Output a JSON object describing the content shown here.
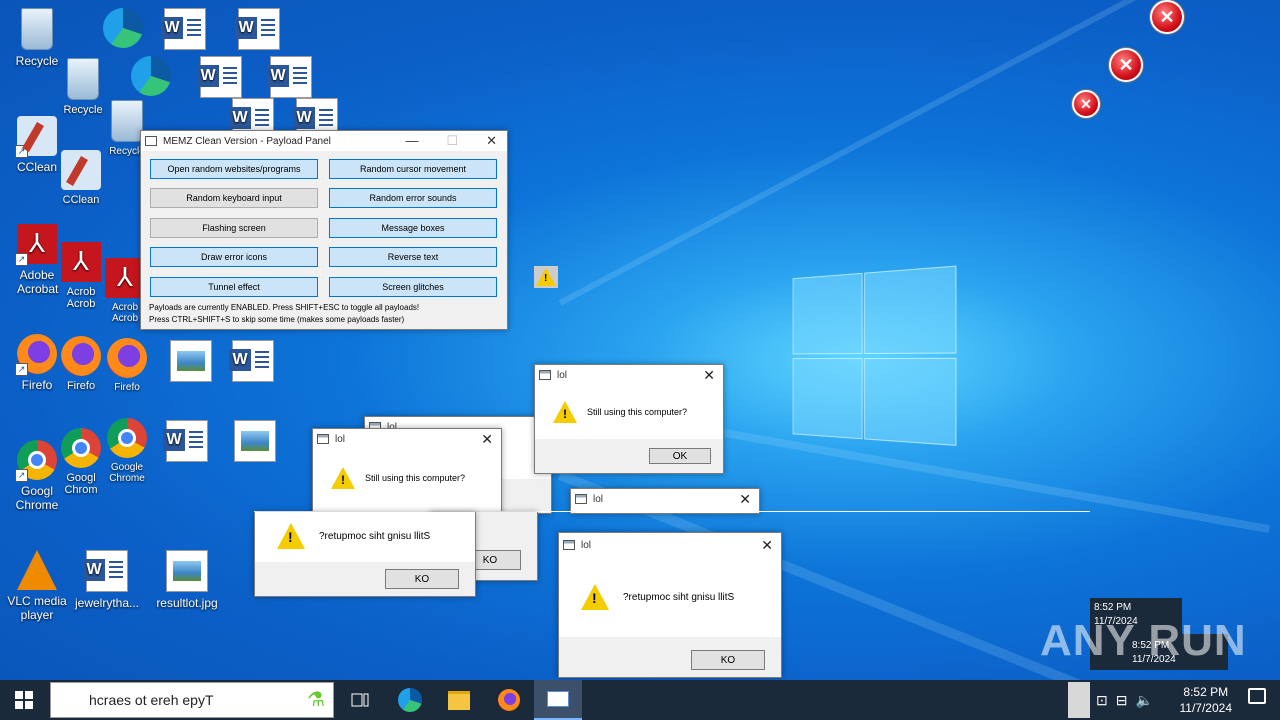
{
  "desktop": {
    "icons": {
      "recycle_label": "Recycle",
      "recycle2_label": "Recycle",
      "recycle3_label": "Recycle",
      "ccleaner_label": "CClean",
      "ccleaner2_label": "CClean",
      "acrobat_label": "Adobe Acrobat",
      "acrobat2_label": "Acrob Acrob",
      "acrobat3_label": "Acrob Acrob",
      "firefox_label": "Firefo",
      "firefox2_label": "Firefo",
      "firefox3_label": "Firefo",
      "chrome_label": "Googl Chrome",
      "chrome2_label": "Googl Chrom",
      "chrome3_label": "Google Chrome",
      "vlc_label": "VLC media player",
      "jewel_label": "jewelrytha...",
      "result_label": "resultlot.jpg"
    }
  },
  "payload_panel": {
    "title": "MEMZ Clean Version - Payload Panel",
    "buttons": [
      {
        "label": "Open random websites/programs"
      },
      {
        "label": "Random cursor movement"
      },
      {
        "label": "Random keyboard input"
      },
      {
        "label": "Random error sounds"
      },
      {
        "label": "Flashing screen"
      },
      {
        "label": "Message boxes"
      },
      {
        "label": "Draw error icons"
      },
      {
        "label": "Reverse text"
      },
      {
        "label": "Tunnel effect"
      },
      {
        "label": "Screen glitches"
      }
    ],
    "status_line1": "Payloads are currently ENABLED. Press SHIFT+ESC to toggle all payloads!",
    "status_line2": "Press CTRL+SHIFT+S to skip some time (makes some payloads faster)"
  },
  "dialogs": {
    "title": "lol",
    "message": "Still using this computer?",
    "message_reversed": "?retupmoc siht gnisu llitS",
    "ok_label": "OK",
    "ok_reversed": "KO"
  },
  "taskbar": {
    "search_text": "hcraes ot ereh epyT",
    "time": "8:52 PM",
    "date": "11/7/2024"
  },
  "ghost_clock": {
    "time": "8:52 PM",
    "date": "11/7/2024"
  },
  "watermark": "ANY RUN",
  "colors": {
    "accent": "#0078d7",
    "taskbar": "#1b2a3a",
    "warning": "#f5cc00",
    "error": "#d4101a"
  }
}
